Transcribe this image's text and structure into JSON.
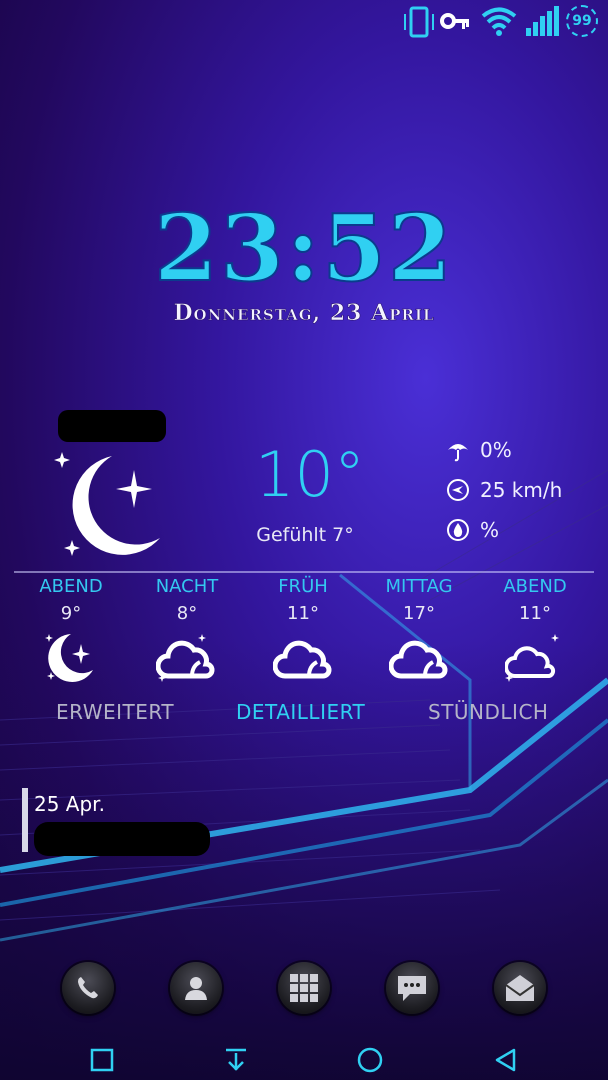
{
  "status_bar": {
    "icons": [
      "vibrate-icon",
      "key-icon",
      "wifi-icon",
      "signal-icon",
      "battery-icon"
    ],
    "battery_level": "99"
  },
  "clock": {
    "time": "23:52",
    "date": "Donnerstag, 23 April"
  },
  "weather": {
    "temperature": "10°",
    "feels_like": "Gefühlt 7°",
    "precipitation": "0%",
    "wind": "25 km/h",
    "humidity": "%",
    "icon": "crescent-moon-stars-icon",
    "forecast": [
      {
        "label": "ABEND",
        "temp": "9°",
        "icon": "moon-icon"
      },
      {
        "label": "NACHT",
        "temp": "8°",
        "icon": "cloud-moon-icon"
      },
      {
        "label": "FRÜH",
        "temp": "11°",
        "icon": "cloud-icon"
      },
      {
        "label": "MITTAG",
        "temp": "17°",
        "icon": "cloud-icon"
      },
      {
        "label": "ABEND",
        "temp": "11°",
        "icon": "partly-cloudy-night-icon"
      }
    ],
    "tabs": [
      {
        "label": "ERWEITERT",
        "active": false
      },
      {
        "label": "DETAILLIERT",
        "active": true
      },
      {
        "label": "STÜNDLICH",
        "active": false
      }
    ]
  },
  "calendar": {
    "date": "25 Apr."
  },
  "dock": [
    "phone-icon",
    "contacts-icon",
    "app-drawer-icon",
    "messages-icon",
    "email-icon"
  ],
  "navigation": [
    "recent-apps-icon",
    "notification-pull-icon",
    "home-icon",
    "back-icon"
  ],
  "colors": {
    "accent": "#30d0f2",
    "tab_inactive": "#b4b4c8",
    "background": "#2a0f7a"
  }
}
